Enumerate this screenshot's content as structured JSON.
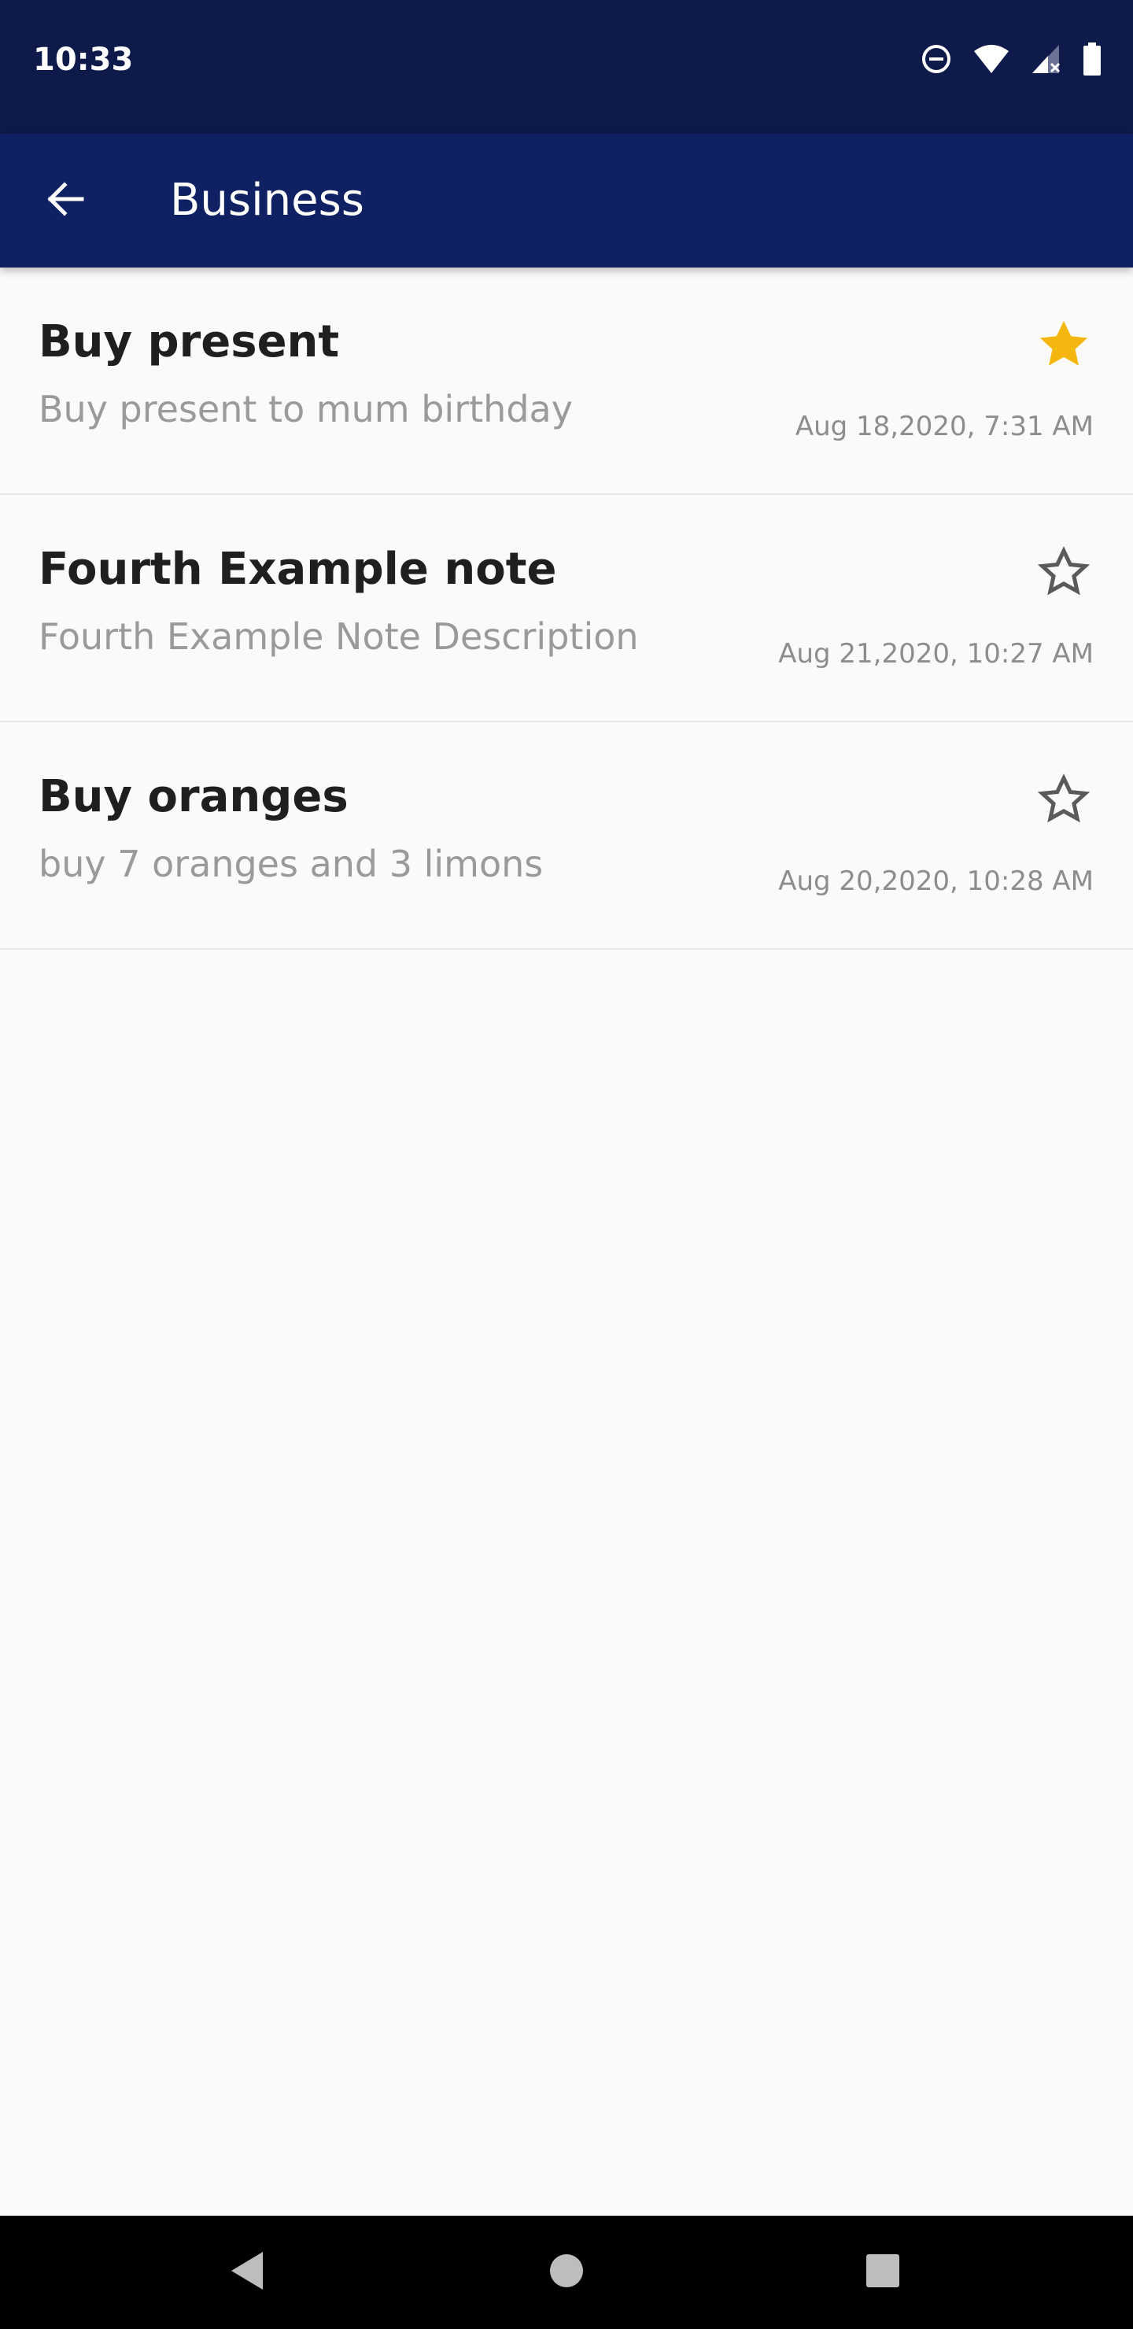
{
  "status_bar": {
    "time": "10:33",
    "icons": [
      "do-not-disturb-icon",
      "wifi-icon",
      "signal-icon",
      "battery-icon"
    ]
  },
  "app_bar": {
    "title": "Business",
    "back_icon": "arrow-back-icon"
  },
  "notes": [
    {
      "title": "Buy present",
      "description": "Buy present to mum birthday",
      "date": "Aug 18,2020, 7:31 AM",
      "starred": true
    },
    {
      "title": "Fourth Example note",
      "description": "Fourth Example Note Description",
      "date": "Aug 21,2020, 10:27 AM",
      "starred": false
    },
    {
      "title": "Buy oranges",
      "description": "buy 7 oranges and 3 limons",
      "date": "Aug 20,2020, 10:28 AM",
      "starred": false
    }
  ],
  "nav_bar": {
    "buttons": [
      "back-triangle-icon",
      "home-circle-icon",
      "recents-square-icon"
    ]
  },
  "colors": {
    "status_bar": "#0d1a4a",
    "app_bar": "#0f2063",
    "star_active": "#f5b70f",
    "star_inactive": "#5a5a5a",
    "background": "#fafafa"
  }
}
